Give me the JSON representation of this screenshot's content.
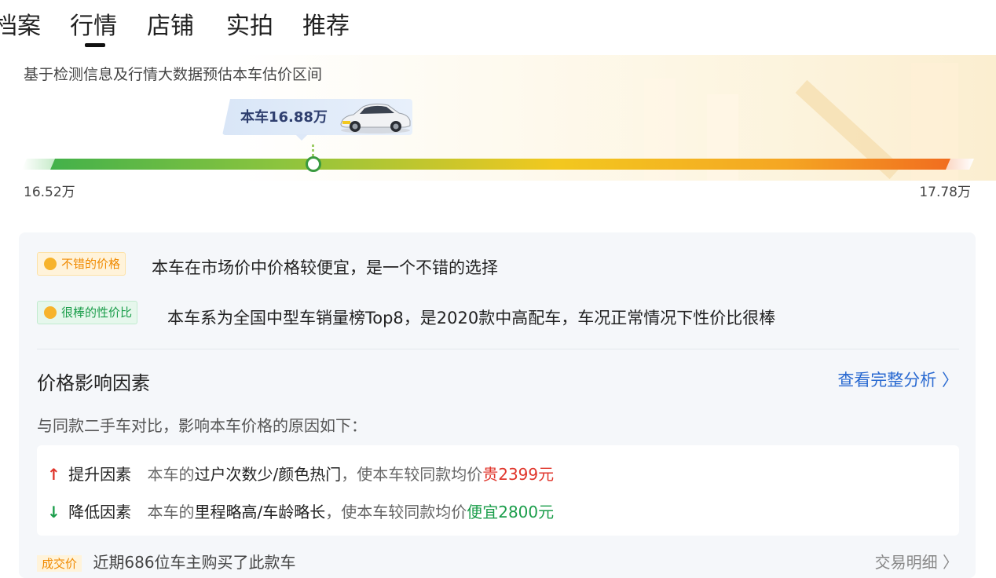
{
  "tabs": [
    {
      "label": "档案"
    },
    {
      "label": "行情",
      "active": true
    },
    {
      "label": "店铺"
    },
    {
      "label": "实拍"
    },
    {
      "label": "推荐"
    }
  ],
  "estimate": {
    "subtitle": "基于检测信息及行情大数据预估本车估价区间",
    "current_price_label": "本车16.88万",
    "min_price": "16.52万",
    "max_price": "17.78万",
    "marker_fraction": 0.286
  },
  "evaluations": [
    {
      "tag": "不错的价格",
      "text": "本车在市场价中价格较便宜，是一个不错的选择",
      "icon": "smile-icon",
      "color": "#f08a00"
    },
    {
      "tag": "很棒的性价比",
      "text": "本车系为全国中型车销量榜Top8，是2020款中高配车，车况正常情况下性价比很棒",
      "icon": "grin-icon",
      "color": "#1a9d4a"
    }
  ],
  "factors": {
    "title": "价格影响因素",
    "link": "查看完整分析 〉",
    "desc": "与同款二手车对比，影响本车价格的原因如下：",
    "up": {
      "label": "提升因素",
      "prefix": "本车的",
      "items": "过户次数少/颜色热门",
      "middle": "，使本车较同款均价",
      "impact": "贵2399元"
    },
    "down": {
      "label": "降低因素",
      "prefix": "本车的",
      "items": "里程略高/车龄略长",
      "middle": "，使本车较同款均价",
      "impact": "便宜2800元"
    }
  },
  "cutoff_row": {
    "tag": "成交价",
    "text": "近期686位车主购买了此款车",
    "link": "交易明细 〉"
  },
  "colors": {
    "accent_blue": "#2a6ad1",
    "price_up_red": "#e0362c",
    "price_down_green": "#1a9d4a",
    "bar_start": "#43b14a",
    "bar_end": "#f0661f"
  }
}
